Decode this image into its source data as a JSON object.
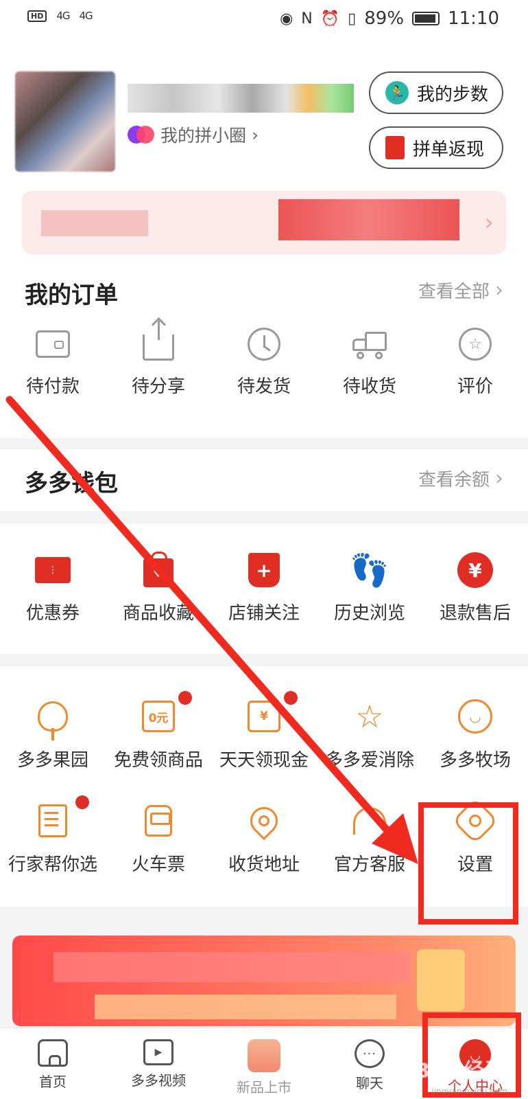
{
  "status_bar": {
    "hd_label": "HD",
    "signal1": "4G",
    "signal2": "4G",
    "battery_pct": "89%",
    "time": "11:10"
  },
  "profile": {
    "circle_link": "我的拼小圈",
    "steps_button": "我的步数",
    "cashback_button": "拼单返现"
  },
  "orders": {
    "title": "我的订单",
    "view_all": "查看全部",
    "items": [
      {
        "label": "待付款",
        "icon": "wallet-icon"
      },
      {
        "label": "待分享",
        "icon": "share-icon"
      },
      {
        "label": "待发货",
        "icon": "clock-icon"
      },
      {
        "label": "待收货",
        "icon": "truck-icon"
      },
      {
        "label": "评价",
        "icon": "review-star-icon"
      }
    ]
  },
  "wallet": {
    "title": "多多钱包",
    "view_balance": "查看余额"
  },
  "features": [
    {
      "label": "优惠券",
      "icon": "coupon-icon"
    },
    {
      "label": "商品收藏",
      "icon": "favorite-bag-icon"
    },
    {
      "label": "店铺关注",
      "icon": "shop-follow-icon"
    },
    {
      "label": "历史浏览",
      "icon": "footprint-icon"
    },
    {
      "label": "退款售后",
      "icon": "refund-yen-icon"
    }
  ],
  "services": {
    "row1": [
      {
        "label": "多多果园",
        "icon": "tree-icon"
      },
      {
        "label": "免费领商品",
        "icon": "free-bag-icon",
        "icon_text": "0元",
        "dot": true
      },
      {
        "label": "天天领现金",
        "icon": "cash-envelope-icon",
        "icon_text": "¥",
        "dot": true
      },
      {
        "label": "多多爱消除",
        "icon": "star-wand-icon"
      },
      {
        "label": "多多牧场",
        "icon": "cow-icon"
      }
    ],
    "row2": [
      {
        "label": "行家帮你选",
        "icon": "expert-note-icon",
        "dot": true
      },
      {
        "label": "火车票",
        "icon": "train-icon"
      },
      {
        "label": "收货地址",
        "icon": "location-pin-icon"
      },
      {
        "label": "官方客服",
        "icon": "headset-icon"
      },
      {
        "label": "设置",
        "icon": "settings-gear-icon"
      }
    ]
  },
  "bottom_nav": [
    {
      "label": "首页",
      "icon": "home-icon"
    },
    {
      "label": "多多视频",
      "icon": "video-tv-icon"
    },
    {
      "label": "新品上市",
      "icon": "new-items-icon"
    },
    {
      "label": "聊天",
      "icon": "chat-icon"
    },
    {
      "label": "个人中心",
      "icon": "profile-icon",
      "active": true
    }
  ],
  "glyphs": {
    "chevron": "›",
    "refund": "¥",
    "shop_plus": "+",
    "review_star": "☆",
    "steps": "🏃",
    "footprint": "👣",
    "chat_dots": "···",
    "tv_play": "▶"
  },
  "colors": {
    "brand_red": "#e02e24",
    "service_orange": "#f0892e",
    "annotation_red": "#f02a1e"
  },
  "watermark": {
    "main": "Bai 经验",
    "sub": "jingyan.baidu.com"
  }
}
